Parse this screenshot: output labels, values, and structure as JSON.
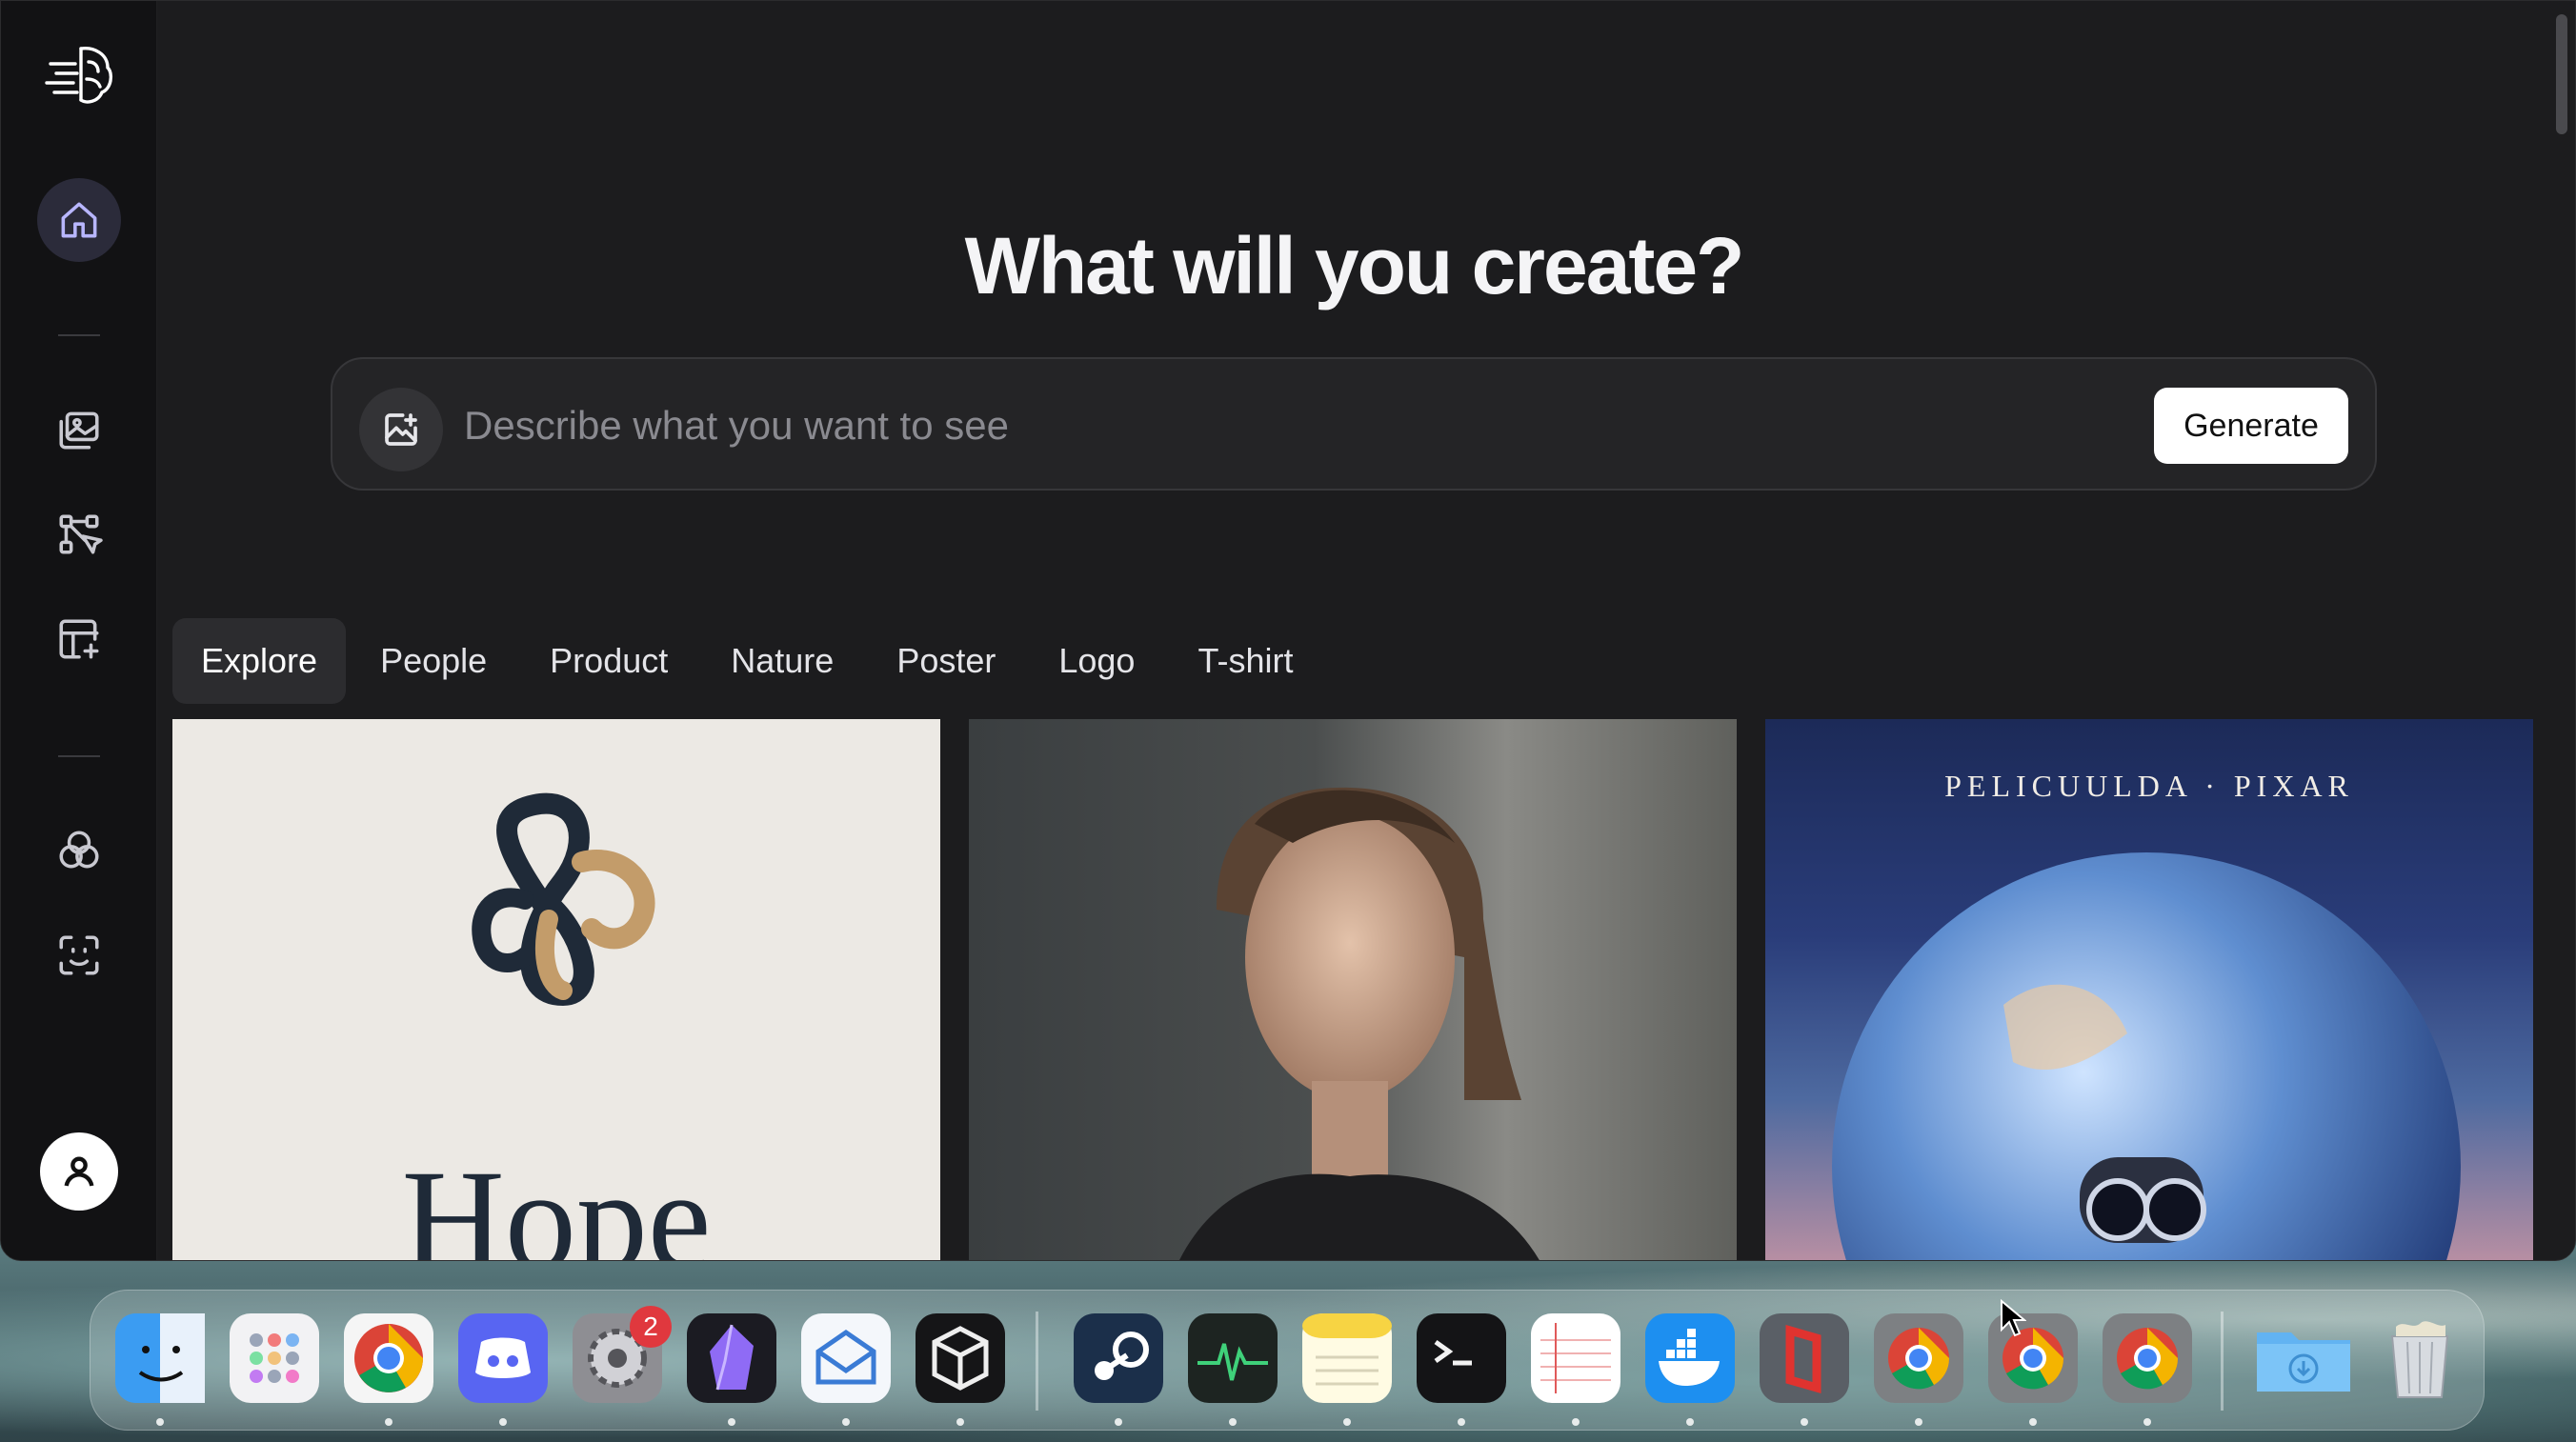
{
  "headline": "What will you create?",
  "prompt": {
    "placeholder": "Describe what you want to see",
    "generate_label": "Generate"
  },
  "tabs": [
    {
      "label": "Explore",
      "active": true
    },
    {
      "label": "People"
    },
    {
      "label": "Product"
    },
    {
      "label": "Nature"
    },
    {
      "label": "Poster"
    },
    {
      "label": "Logo"
    },
    {
      "label": "T-shirt"
    }
  ],
  "cards": [
    {
      "text": "Hope"
    },
    {
      "text": ""
    },
    {
      "text": "PELICUULDA · PIXAR"
    }
  ],
  "dock": {
    "settings_badge": "2"
  },
  "colors": {
    "background": "#1c1c1e",
    "sidebar": "#121214",
    "accent": "#b8b6ff",
    "generate_button": "#ffffff"
  }
}
